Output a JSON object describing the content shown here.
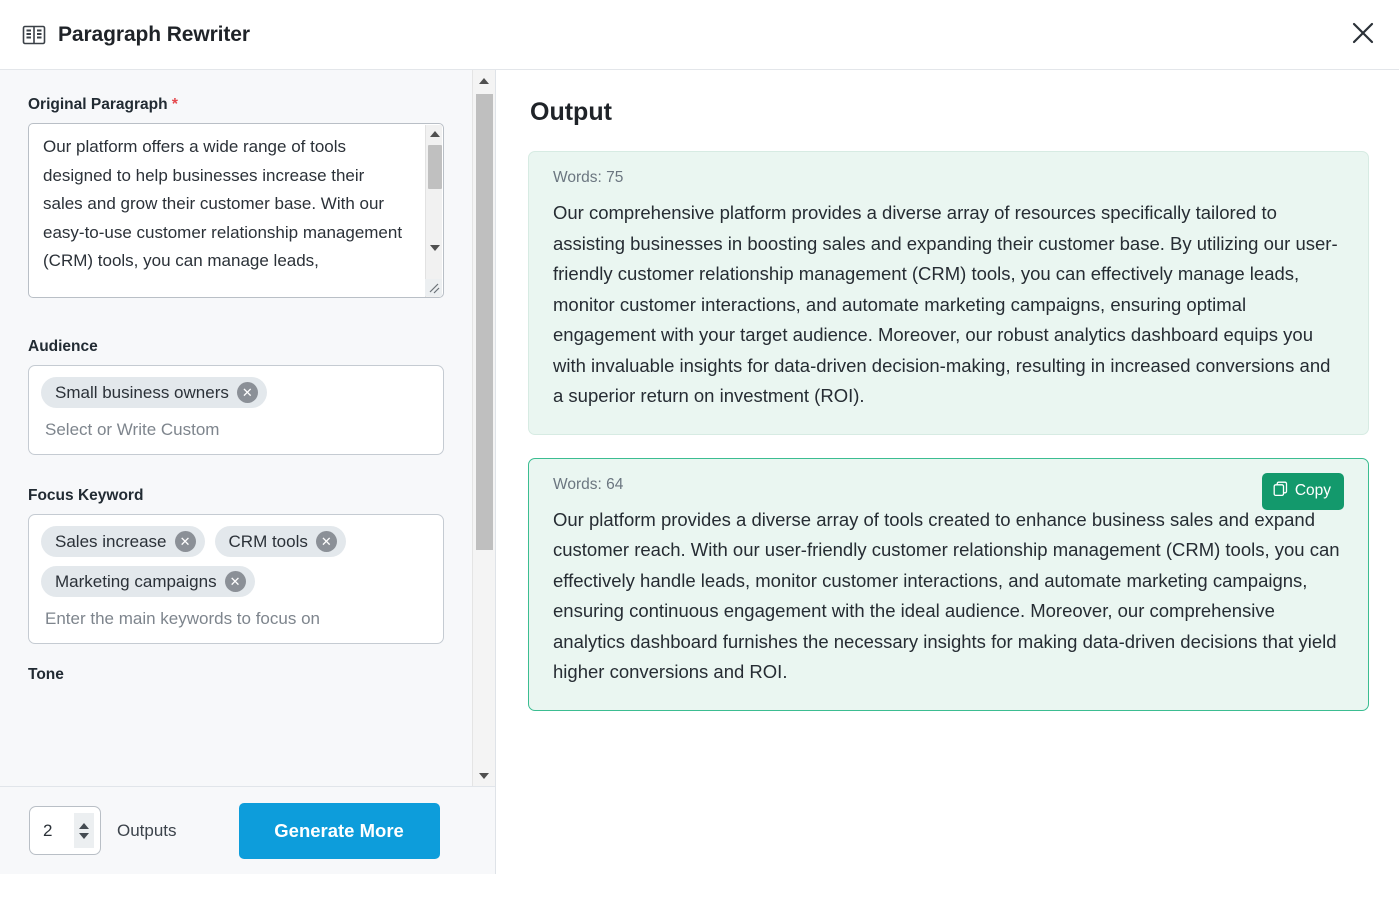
{
  "header": {
    "title": "Paragraph Rewriter",
    "icon": "book-open-icon",
    "close_icon": "close-icon"
  },
  "form": {
    "original_paragraph": {
      "label": "Original Paragraph",
      "required_marker": "*",
      "value": "Our platform offers a wide range of tools designed to help businesses increase their sales and grow their customer base. With our easy-to-use customer relationship management (CRM) tools, you can manage leads,"
    },
    "audience": {
      "label": "Audience",
      "tags": [
        "Small business owners"
      ],
      "placeholder": "Select or Write Custom"
    },
    "focus_keyword": {
      "label": "Focus Keyword",
      "tags": [
        "Sales increase",
        "CRM tools",
        "Marketing campaigns"
      ],
      "placeholder": "Enter the main keywords to focus on"
    },
    "tone": {
      "label": "Tone"
    }
  },
  "footer": {
    "outputs_value": "2",
    "outputs_label": "Outputs",
    "generate_label": "Generate More"
  },
  "output": {
    "title": "Output",
    "cards": [
      {
        "words_label": "Words: 75",
        "text": "Our comprehensive platform provides a diverse array of resources specifically tailored to assisting businesses in boosting sales and expanding their customer base. By utilizing our user-friendly customer relationship management (CRM) tools, you can effectively manage leads, monitor customer interactions, and automate marketing campaigns, ensuring optimal engagement with your target audience. Moreover, our robust analytics dashboard equips you with invaluable insights for data-driven decision-making, resulting in increased conversions and a superior return on investment (ROI).",
        "copy_label": ""
      },
      {
        "words_label": "Words: 64",
        "text": "Our platform provides a diverse array of tools created to enhance business sales and expand customer reach. With our user-friendly customer relationship management (CRM) tools, you can effectively handle leads, monitor customer interactions, and automate marketing campaigns, ensuring continuous engagement with the ideal audience. Moreover, our comprehensive analytics dashboard furnishes the necessary insights for making data-driven decisions that yield higher conversions and ROI.",
        "copy_label": "Copy"
      }
    ]
  },
  "colors": {
    "accent_blue": "#0d9ddb",
    "accent_green": "#13996c",
    "card_bg": "#eaf6f1",
    "card_active_border": "#3bbd91",
    "required_red": "#e5484d"
  }
}
